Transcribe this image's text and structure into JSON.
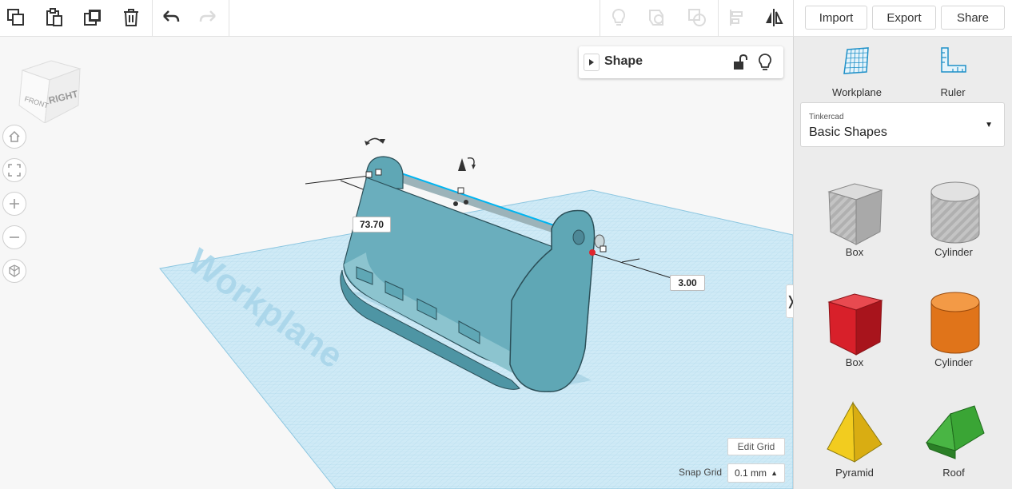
{
  "toolbar": {
    "icons": [
      "copy-icon",
      "paste-icon",
      "duplicate-icon",
      "delete-icon",
      "undo-icon",
      "redo-icon",
      "note-icon",
      "group-icon",
      "ungroup-icon",
      "align-icon",
      "mirror-icon"
    ]
  },
  "header": {
    "import_label": "Import",
    "export_label": "Export",
    "share_label": "Share"
  },
  "viewcube": {
    "front_label": "FRONT",
    "right_label": "RIGHT"
  },
  "workplane_text": "Workplane",
  "shape_panel": {
    "title": "Shape"
  },
  "dimensions": {
    "length": "73.70",
    "offset": "3.00"
  },
  "grid": {
    "edit_label": "Edit Grid",
    "snap_label": "Snap Grid",
    "snap_value": "0.1 mm"
  },
  "sidebar": {
    "workplane_label": "Workplane",
    "ruler_label": "Ruler",
    "library_small": "Tinkercad",
    "library_name": "Basic Shapes",
    "shapes": [
      {
        "label": "Box",
        "color": "#bdbdbd"
      },
      {
        "label": "Cylinder",
        "color": "#c8c8c8"
      },
      {
        "label": "Box",
        "color": "#d8202a"
      },
      {
        "label": "Cylinder",
        "color": "#e0741a"
      },
      {
        "label": "Pyramid",
        "color": "#f2cc1f"
      },
      {
        "label": "Roof",
        "color": "#3aa535"
      }
    ]
  },
  "colors": {
    "object": "#5fa7b5",
    "grid": "#bfe3f0",
    "accent": "#00a0e0"
  }
}
